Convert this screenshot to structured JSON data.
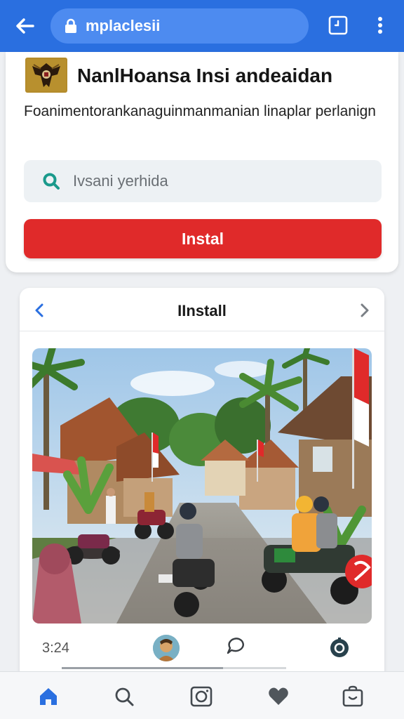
{
  "browser": {
    "url_text": "mplaclesii"
  },
  "card1": {
    "title": "NanlHoansa Insi andeaidan",
    "description": "Foanimentorankanaguinmanmanian linaplar perlanign",
    "search": {
      "placeholder": "Ivsani yerhida"
    },
    "install_label": "Instal"
  },
  "card2": {
    "title": "IInstall",
    "time": "3:24",
    "progress": 0.72
  },
  "bottom_nav": {
    "items": [
      {
        "icon": "home-icon",
        "active": true
      },
      {
        "icon": "search-icon",
        "active": false
      },
      {
        "icon": "camera-icon",
        "active": false
      },
      {
        "icon": "heart-icon",
        "active": false
      },
      {
        "icon": "bag-icon",
        "active": false
      }
    ]
  },
  "colors": {
    "header": "#2a6fe0",
    "accent_red": "#e02a2a",
    "nav_active": "#2a6fe0",
    "nav_inactive": "#5c6166"
  }
}
